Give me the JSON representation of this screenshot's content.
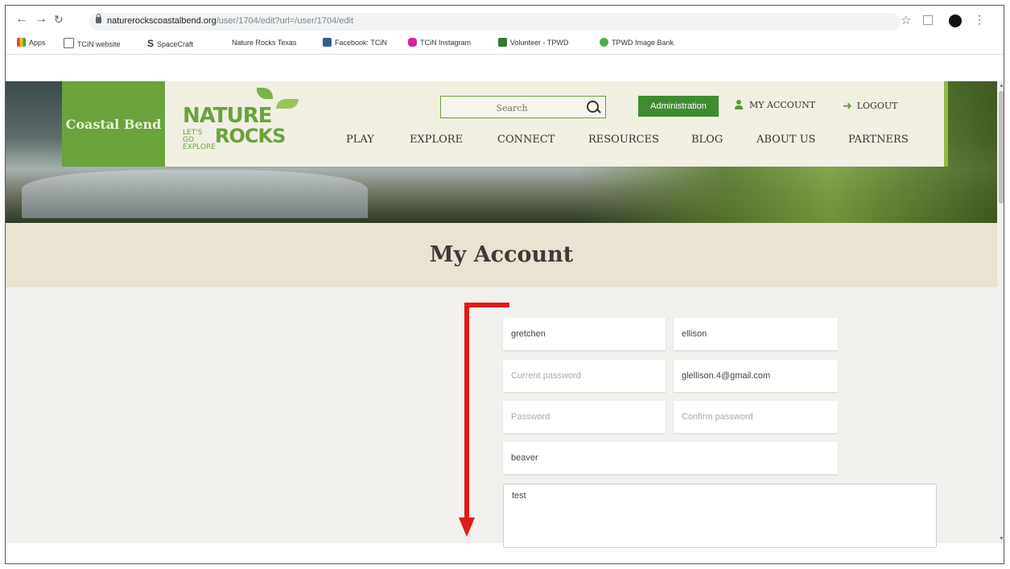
{
  "browser": {
    "url_host": "naturerockscoastalbend.org",
    "url_path": "/user/1704/edit?url=/user/1704/edit",
    "bookmarks": [
      {
        "label": "Apps",
        "color": "#e8452c"
      },
      {
        "label": "TCiN website",
        "color": "#666666"
      },
      {
        "label": "SpaceCraft",
        "color": "#111111"
      },
      {
        "label": "Nature Rocks Texas",
        "color": "#ffffff"
      },
      {
        "label": "Facebook: TCiN",
        "color": "#3b5998"
      },
      {
        "label": "TCiN Instagram",
        "color": "#d6249f"
      },
      {
        "label": "Volunteer - TPWD",
        "color": "#2e7d32"
      },
      {
        "label": "TPWD Image Bank",
        "color": "#4caf50"
      }
    ]
  },
  "header": {
    "region": "Coastal Bend",
    "logo": {
      "line1": "NATURE",
      "line2": "LET'S GO EXPLORE",
      "line3": "ROCKS"
    },
    "search_placeholder": "Search",
    "admin_label": "Administration",
    "account_label": "MY ACCOUNT",
    "logout_label": "LOGOUT",
    "nav": [
      "PLAY",
      "EXPLORE",
      "CONNECT",
      "RESOURCES",
      "BLOG",
      "ABOUT US",
      "PARTNERS"
    ]
  },
  "page": {
    "title": "My Account"
  },
  "form": {
    "first_name": "gretchen",
    "last_name": "ellison",
    "current_password_placeholder": "Current password",
    "email": "glellison.4@gmail.com",
    "password_placeholder": "Password",
    "confirm_password_placeholder": "Confirm password",
    "username": "beaver",
    "bio": "test"
  },
  "colors": {
    "brand_green": "#6aa33b",
    "admin_green": "#3f8b32",
    "annotation_red": "#e01a1a"
  }
}
